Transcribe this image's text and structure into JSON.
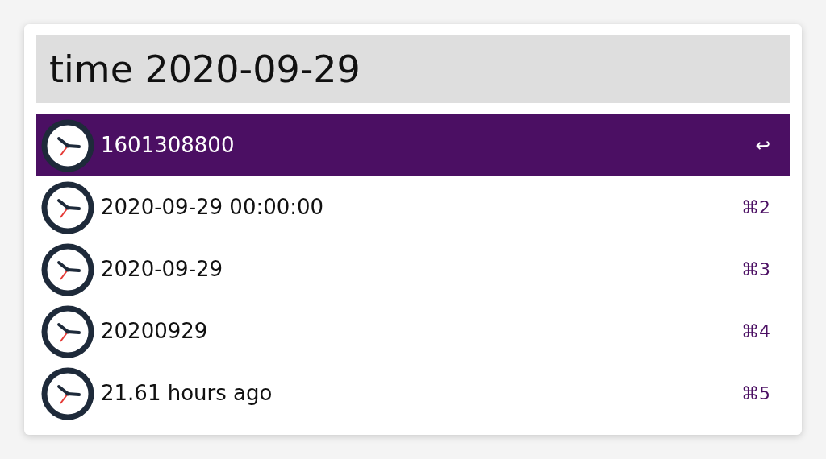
{
  "search": {
    "value": "time 2020-09-29"
  },
  "results": [
    {
      "title": "1601308800",
      "shortcut": "↩",
      "selected": true
    },
    {
      "title": "2020-09-29 00:00:00",
      "shortcut": "⌘2",
      "selected": false
    },
    {
      "title": "2020-09-29",
      "shortcut": "⌘3",
      "selected": false
    },
    {
      "title": "20200929",
      "shortcut": "⌘4",
      "selected": false
    },
    {
      "title": "21.61 hours ago",
      "shortcut": "⌘5",
      "selected": false
    }
  ]
}
